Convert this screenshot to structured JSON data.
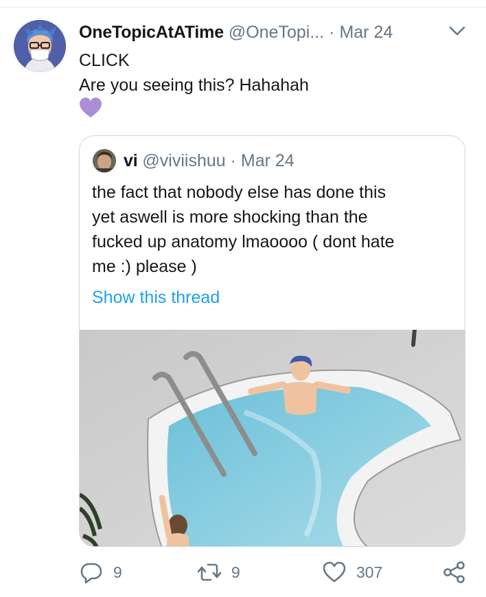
{
  "tweet": {
    "author_name": "OneTopicAtATime",
    "author_handle": "@OneTopi...",
    "separator": "·",
    "date": "Mar 24",
    "lines": [
      "CLICK",
      "Are you seeing this? Hahahah"
    ],
    "emoji": "purple-heart"
  },
  "quoted": {
    "author_name": "vi",
    "author_handle": "@viviishuu",
    "separator": "·",
    "date": "Mar 24",
    "lines": [
      "the fact that nobody else has done this",
      "yet aswell is more shocking than the",
      "fucked up anatomy lmaoooo ( dont hate",
      "me :) please )"
    ],
    "link": "Show this thread",
    "image_description_icon": "pool-illustration"
  },
  "actions": {
    "reply_count": "9",
    "retweet_count": "9",
    "like_count": "307",
    "icons": [
      "reply-icon",
      "retweet-icon",
      "like-icon",
      "share-icon"
    ]
  },
  "colors": {
    "link": "#1da1f2",
    "muted": "#657786",
    "text": "#14171a",
    "border": "#ccd6dd",
    "heart": "#aa8ed6"
  }
}
